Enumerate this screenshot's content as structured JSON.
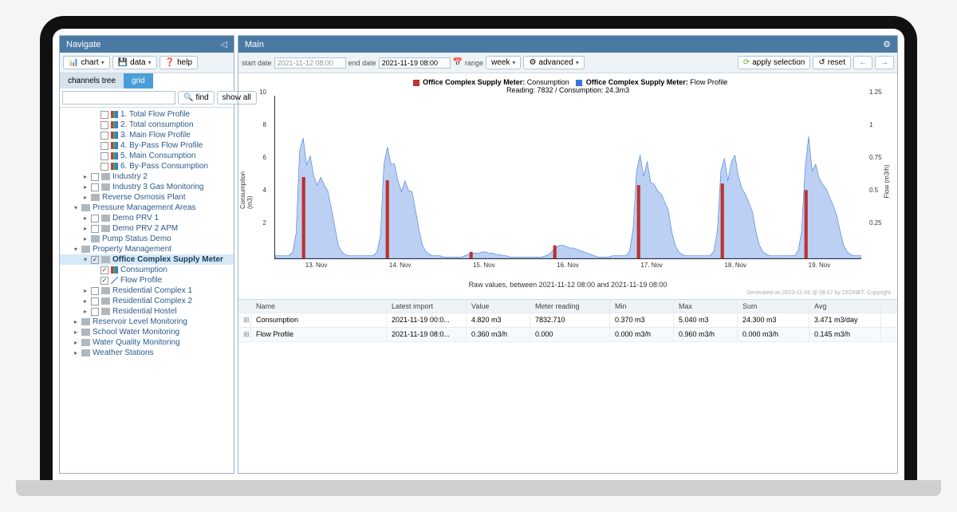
{
  "sidebar": {
    "title": "Navigate",
    "buttons": {
      "chart": "chart",
      "data": "data",
      "help": "help"
    },
    "tabs": {
      "channels": "channels tree",
      "grid": "grid"
    },
    "search": {
      "find": "find",
      "show_all": "show all"
    },
    "tree": [
      {
        "indent": 3,
        "cb": false,
        "icon": "bar",
        "label": "1. Total Flow Profile"
      },
      {
        "indent": 3,
        "cb": false,
        "icon": "bar",
        "label": "2. Total consumption"
      },
      {
        "indent": 3,
        "cb": false,
        "icon": "bar",
        "label": "3. Main Flow Profile"
      },
      {
        "indent": 3,
        "cb": false,
        "icon": "bar",
        "label": "4. By-Pass Flow Profile"
      },
      {
        "indent": 3,
        "cb": false,
        "icon": "bar",
        "label": "5. Main Consumption"
      },
      {
        "indent": 3,
        "cb": false,
        "icon": "bar",
        "label": "6. By-Pass Consumption"
      },
      {
        "indent": 2,
        "arrow": "▸",
        "cb": false,
        "icon": "folder",
        "label": "Industry 2"
      },
      {
        "indent": 2,
        "arrow": "▸",
        "cb": false,
        "icon": "folder",
        "label": "Industry 3 Gas Monitoring"
      },
      {
        "indent": 2,
        "arrow": "▸",
        "icon": "folder",
        "label": "Reverse Osmosis Plant"
      },
      {
        "indent": 1,
        "arrow": "▾",
        "icon": "folder",
        "label": "Pressure Management Areas"
      },
      {
        "indent": 2,
        "arrow": "▸",
        "cb": false,
        "icon": "folder",
        "label": "Demo PRV 1"
      },
      {
        "indent": 2,
        "arrow": "▸",
        "cb": false,
        "icon": "folder",
        "label": "Demo PRV 2 APM"
      },
      {
        "indent": 2,
        "arrow": "▸",
        "icon": "folder",
        "label": "Pump Status Demo"
      },
      {
        "indent": 1,
        "arrow": "▾",
        "icon": "folder",
        "label": "Property Management"
      },
      {
        "indent": 2,
        "arrow": "▾",
        "cb": true,
        "icon": "folder",
        "label": "Office Complex Supply Meter",
        "selected": true,
        "bold": true
      },
      {
        "indent": 3,
        "cb": true,
        "icon": "bar",
        "label": "Consumption"
      },
      {
        "indent": 3,
        "cb": true,
        "icon": "line",
        "label": "Flow Profile"
      },
      {
        "indent": 2,
        "arrow": "▸",
        "cb": false,
        "icon": "folder",
        "label": "Residential Complex 1"
      },
      {
        "indent": 2,
        "arrow": "▸",
        "cb": false,
        "icon": "folder",
        "label": "Residential Complex 2"
      },
      {
        "indent": 2,
        "arrow": "▸",
        "cb": false,
        "icon": "folder",
        "label": "Residential Hostel"
      },
      {
        "indent": 1,
        "arrow": "▸",
        "icon": "folder",
        "label": "Reservoir Level Monitoring"
      },
      {
        "indent": 1,
        "arrow": "▸",
        "icon": "folder",
        "label": "School Water Monitoring"
      },
      {
        "indent": 1,
        "arrow": "▸",
        "icon": "folder",
        "label": "Water Quality Monitoring"
      },
      {
        "indent": 1,
        "arrow": "▸",
        "icon": "folder",
        "label": "Weather Stations"
      }
    ]
  },
  "main": {
    "title": "Main",
    "toolbar": {
      "start_label": "start date",
      "start_value": "2021-11-12 08:00",
      "end_label": "end date",
      "end_value": "2021-11-19 08:00",
      "range_label": "range",
      "range_value": "week",
      "advanced": "advanced",
      "apply": "apply selection",
      "reset": "reset"
    },
    "legend": {
      "series1_name": "Office Complex Supply Meter:",
      "series1_val": "Consumption",
      "series2_name": "Office Complex Supply Meter:",
      "series2_val": "Flow Profile",
      "sub": "Reading: 7832 / Consumption: 24.3m3"
    },
    "chart_caption": "Raw values, between 2021-11-12 08:00 and 2021-11-19 08:00",
    "generated": "Generated on 2023-11-09 @ 08:07 by ZEDNET. Copyright",
    "grid": {
      "headers": [
        "Name",
        "Latest import",
        "Value",
        "Meter reading",
        "Min",
        "Max",
        "Sum",
        "Avg"
      ],
      "rows": [
        {
          "name": "Consumption",
          "li": "2021-11-19 00:0...",
          "val": "4.820 m3",
          "mr": "7832.710",
          "min": "0.370 m3",
          "max": "5.040 m3",
          "sum": "24.300 m3",
          "avg": "3.471 m3/day"
        },
        {
          "name": "Flow Profile",
          "li": "2021-11-19 08:0...",
          "val": "0.360 m3/h",
          "mr": "0.000",
          "min": "0.000 m3/h",
          "max": "0.960 m3/h",
          "sum": "0.000 m3/h",
          "avg": "0.145 m3/h"
        }
      ]
    }
  },
  "chart_data": {
    "type": "area+bar",
    "title": "Office Complex Supply Meter",
    "xlabel": "",
    "y_left_label": "Consumption (m3)",
    "y_right_label": "Flow (m3/h)",
    "x_ticks": [
      "13. Nov",
      "14. Nov",
      "15. Nov",
      "16. Nov",
      "17. Nov",
      "18. Nov",
      "19. Nov"
    ],
    "y_left_ticks": [
      2,
      4,
      6,
      8,
      10
    ],
    "ylim_left": [
      0,
      10
    ],
    "y_right_ticks": [
      0.25,
      0.5,
      0.75,
      1,
      1.25
    ],
    "ylim_right": [
      0,
      1.25
    ],
    "series": [
      {
        "name": "Consumption",
        "type": "bar",
        "color": "#b33",
        "x_day_index": [
          0,
          1,
          2,
          3,
          4,
          5,
          6
        ],
        "values": [
          5.0,
          4.8,
          0.4,
          0.8,
          4.5,
          4.6,
          4.2
        ]
      },
      {
        "name": "Flow Profile",
        "type": "area",
        "color": "#37d",
        "note": "15-min flow profile, approximated per-hour",
        "x_hours": [
          0,
          1,
          2,
          3,
          4,
          5,
          6,
          7,
          8,
          9,
          10,
          11,
          12,
          13,
          14,
          15,
          16,
          17,
          18,
          19,
          20,
          21,
          22,
          23
        ],
        "days": [
          [
            0.02,
            0.02,
            0.02,
            0.02,
            0.02,
            0.05,
            0.2,
            0.8,
            0.9,
            0.7,
            0.82,
            0.65,
            0.58,
            0.6,
            0.55,
            0.5,
            0.4,
            0.25,
            0.1,
            0.05,
            0.03,
            0.02,
            0.02,
            0.02
          ],
          [
            0.02,
            0.02,
            0.02,
            0.02,
            0.02,
            0.05,
            0.18,
            0.7,
            0.85,
            0.68,
            0.75,
            0.6,
            0.55,
            0.58,
            0.52,
            0.48,
            0.38,
            0.22,
            0.1,
            0.05,
            0.03,
            0.02,
            0.02,
            0.02
          ],
          [
            0.01,
            0.01,
            0.01,
            0.01,
            0.01,
            0.01,
            0.02,
            0.03,
            0.04,
            0.04,
            0.04,
            0.05,
            0.05,
            0.04,
            0.04,
            0.03,
            0.03,
            0.02,
            0.02,
            0.01,
            0.01,
            0.01,
            0.01,
            0.01
          ],
          [
            0.01,
            0.01,
            0.01,
            0.01,
            0.01,
            0.02,
            0.03,
            0.06,
            0.08,
            0.1,
            0.1,
            0.09,
            0.08,
            0.08,
            0.07,
            0.06,
            0.05,
            0.04,
            0.03,
            0.02,
            0.01,
            0.01,
            0.01,
            0.01
          ],
          [
            0.02,
            0.02,
            0.02,
            0.02,
            0.02,
            0.06,
            0.22,
            0.72,
            0.8,
            0.65,
            0.7,
            0.58,
            0.55,
            0.55,
            0.5,
            0.45,
            0.35,
            0.2,
            0.1,
            0.05,
            0.03,
            0.02,
            0.02,
            0.02
          ],
          [
            0.02,
            0.02,
            0.02,
            0.02,
            0.02,
            0.06,
            0.2,
            0.7,
            0.78,
            0.63,
            0.72,
            0.78,
            0.6,
            0.55,
            0.5,
            0.45,
            0.35,
            0.2,
            0.1,
            0.05,
            0.03,
            0.02,
            0.02,
            0.02
          ],
          [
            0.02,
            0.02,
            0.02,
            0.02,
            0.02,
            0.06,
            0.2,
            0.68,
            0.96,
            0.7,
            0.74,
            0.6,
            0.55,
            0.52,
            0.48,
            0.42,
            0.34,
            0.2,
            0.1,
            0.05,
            0.03,
            0.02,
            0.02,
            0.02
          ]
        ]
      }
    ]
  }
}
